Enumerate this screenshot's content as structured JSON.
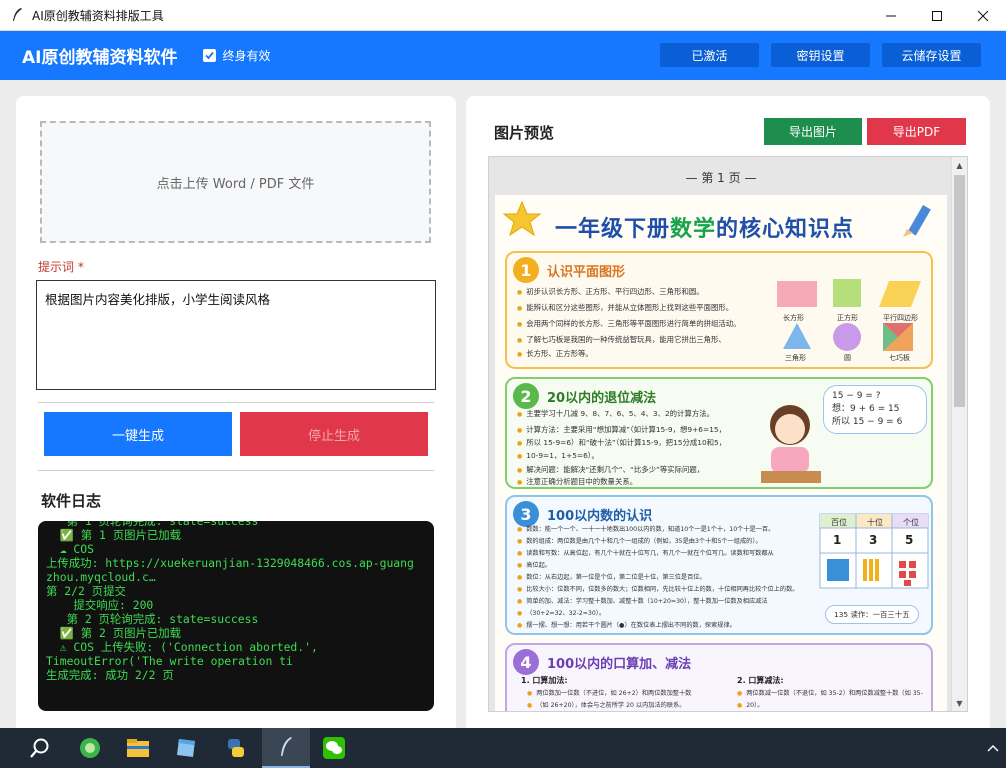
{
  "window": {
    "title": "AI原创教辅资料排版工具"
  },
  "header": {
    "brand": "AI原创教辅资料软件",
    "lifetime_label": "终身有效",
    "activated_label": "已激活",
    "key_settings_label": "密钥设置",
    "cloud_settings_label": "云储存设置"
  },
  "left": {
    "upload_text": "点击上传 Word / PDF 文件",
    "prompt_label": "提示词 *",
    "prompt_value": "根据图片内容美化排版，小学生阅读风格",
    "generate_label": "一键生成",
    "stop_label": "停止生成",
    "log_title": "软件日志",
    "log_lines": [
      "   第 1 页轮询完成: state=success",
      "  ✅ 第 1 页图片已加载",
      "  ☁ COS",
      "上传成功: https://xuekeruanjian-1329048466.cos.ap-guang",
      "zhou.myqcloud.c…",
      "第 2/2 页提交",
      "    提交响应: 200",
      "   第 2 页轮询完成: state=success",
      "  ✅ 第 2 页图片已加载",
      "  ⚠ COS 上传失败: ('Connection aborted.',",
      "TimeoutError('The write operation ti",
      "生成完成: 成功 2/2 页"
    ]
  },
  "right": {
    "preview_title": "图片预览",
    "export_image_label": "导出图片",
    "export_pdf_label": "导出PDF",
    "page_label": "— 第 1 页 —"
  },
  "worksheet": {
    "title_prefix": "一年级下册",
    "title_highlight": "数学",
    "title_suffix": "的核心知识点",
    "sections": [
      {
        "num": "1",
        "title": "认识平面图形",
        "bullets": [
          "初步认识长方形、正方形、平行四边形、三角形和圆。",
          "能辨认和区分这些图形，并能从立体图形上找到这些平面图形。",
          "会用两个同样的长方形、三角形等平面图形进行简单的拼组活动。",
          "了解七巧板是我国的一种传统益智玩具，能用它拼出三角形、",
          "长方形、正方形等。"
        ],
        "shapes": [
          "长方形",
          "正方形",
          "平行四边形",
          "三角形",
          "圆",
          "七巧板"
        ]
      },
      {
        "num": "2",
        "title": "20以内的退位减法",
        "bullets": [
          "主要学习十几减 9、8、7、6、5、4、3、2的计算方法。",
          "计算方法：主要采用“想加算减”（如计算15-9，想9+6=15，",
          "所以 15-9=6）和“破十法”（如计算15-9，把15分成10和5，",
          "10-9=1，1+5=6）。",
          "解决问题：能解决“还剩几个”、“比多少”等实际问题，",
          "注意正确分析题目中的数量关系。"
        ],
        "bubble_lines": [
          "15 − 9 = ?",
          "想：9 + 6 = 15",
          "所以 15 − 9 = 6"
        ]
      },
      {
        "num": "3",
        "title": "100以内数的认识",
        "bullets": [
          "数数：能一个一个、一十一十地数出100以内的数，知道10个一是1个十，10个十是一百。",
          "数的组成：两位数是由几个十和几个一组成的（例如，35是由3个十和5个一组成的）。",
          "读数和写数：从高位起，有几个十就在十位写几，有几个一就在个位写几。读数和写数都从",
          "高位起。",
          "数位：从右边起，第一位是个位，第二位是十位，第三位是百位。",
          "比较大小：位数不同，位数多的数大；位数相同，先比较十位上的数，十位相同再比较个位上的数。",
          "简单的加、减法：学习整十数加、减整十数（10+20=30），整十数加一位数及相应减法",
          "（30+2=32、32-2=30）。",
          "摆一摆、想一想：用若干个圆片（●）在数位表上摆出不同的数，探索规律。"
        ],
        "place_headers": [
          "百位",
          "十位",
          "个位"
        ],
        "place_values": [
          "1",
          "3",
          "5"
        ],
        "read_label": "135 读作：一百三十五"
      },
      {
        "num": "4",
        "title": "100以内的口算加、减法",
        "sub1_title": "1. 口算加法:",
        "sub1_lines": [
          "两位数加一位数（不进位，如 26+2）和两位数加整十数",
          "（如 26+20），体会与之前所学 20 以内加法的联系。"
        ],
        "sub2_title": "2. 口算减法:",
        "sub2_lines": [
          "两位数减一位数（不退位，如 35-2）和两位数减整十数（如 35-",
          "20）。"
        ]
      }
    ]
  },
  "colors": {
    "accent": "#1677ff",
    "danger": "#e0384a",
    "success": "#1e8e4f",
    "log_text": "#3ddc51"
  }
}
